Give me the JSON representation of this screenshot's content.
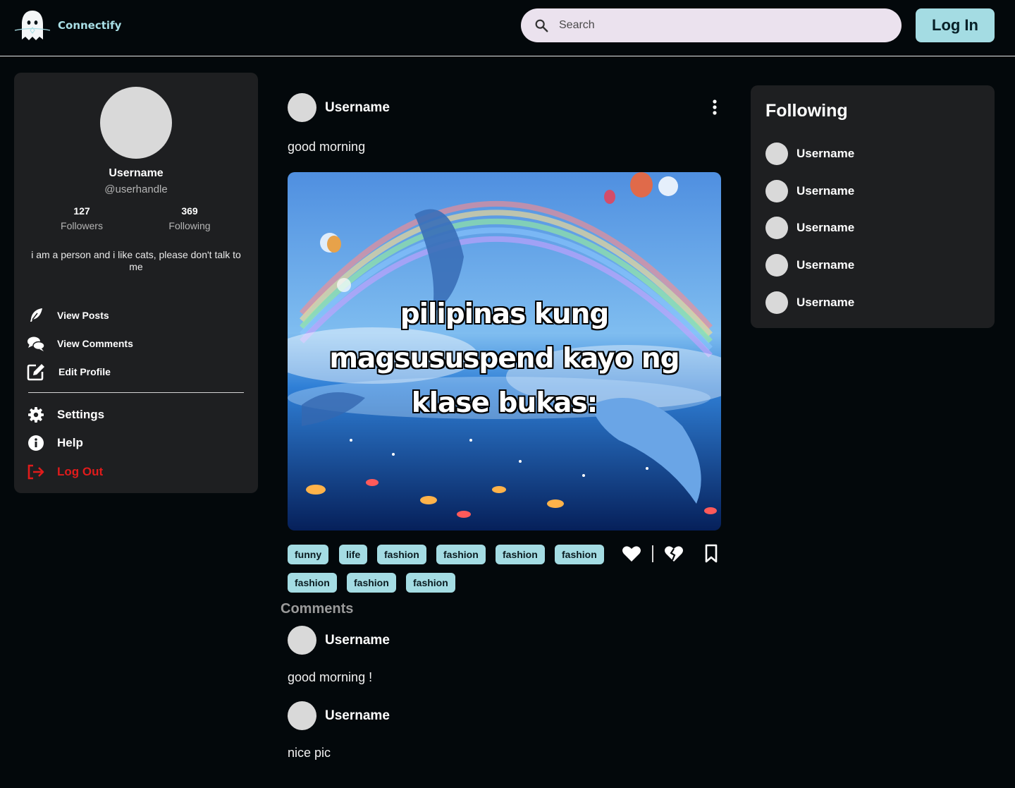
{
  "header": {
    "brand_name": "Connectify",
    "search_placeholder": "Search",
    "login_label": "Log In"
  },
  "profile": {
    "username": "Username",
    "handle": "@userhandle",
    "followers_count": "127",
    "followers_label": "Followers",
    "following_count": "369",
    "following_label": "Following",
    "bio": "i am a person and i like cats, please don't talk to me",
    "menu": {
      "view_posts": "View Posts",
      "view_comments": "View Comments",
      "edit_profile": "Edit Profile",
      "settings": "Settings",
      "help": "Help",
      "log_out": "Log Out"
    }
  },
  "post": {
    "username": "Username",
    "text": "good morning",
    "image_caption_lines": [
      "pilipinas kung",
      "magsususpend kayo ng",
      "klase bukas:"
    ],
    "tags": [
      "funny",
      "life",
      "fashion",
      "fashion",
      "fashion",
      "fashion",
      "fashion",
      "fashion",
      "fashion"
    ],
    "icons": {
      "like": "heart-icon",
      "dislike": "broken-heart-icon",
      "save": "bookmark-icon",
      "more": "kebab-menu-icon"
    }
  },
  "comments": {
    "title": "Comments",
    "items": [
      {
        "username": "Username",
        "text": "good morning !"
      },
      {
        "username": "Username",
        "text": "nice pic"
      }
    ]
  },
  "following": {
    "title": "Following",
    "users": [
      "Username",
      "Username",
      "Username",
      "Username",
      "Username"
    ]
  },
  "colors": {
    "background": "#03080b",
    "card": "#1e1f21",
    "accent": "#a4dce3",
    "danger": "#e01b1b",
    "search_bg": "#ebe2ee"
  }
}
